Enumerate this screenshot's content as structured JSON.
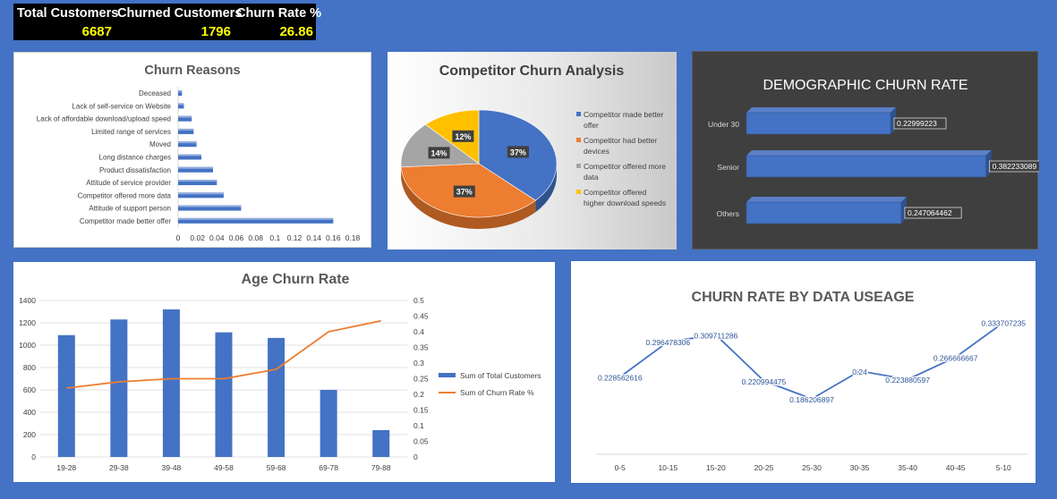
{
  "kpis": {
    "total_customers_label": "Total Customers",
    "total_customers_value": "6687",
    "churned_customers_label": "Churned Customers",
    "churned_customers_value": "1796",
    "churn_rate_label": "Churn Rate %",
    "churn_rate_value": "26.86"
  },
  "chart_data": [
    {
      "type": "bar",
      "orientation": "horizontal",
      "title": "Churn Reasons",
      "categories": [
        "Deceased",
        "Lack of self-service on Website",
        "Lack of affordable download/upload speed",
        "Limited range of services",
        "Moved",
        "Long distance charges",
        "Product dissatisfaction",
        "Attitude of service provider",
        "Competitor offered more data",
        "Attitude of support person",
        "Competitor made better offer"
      ],
      "values": [
        0.004,
        0.006,
        0.014,
        0.016,
        0.019,
        0.024,
        0.036,
        0.04,
        0.047,
        0.065,
        0.16
      ],
      "xlim": [
        0,
        0.18
      ],
      "xticks": [
        "0",
        "0.02",
        "0.04",
        "0.06",
        "0.08",
        "0.1",
        "0.12",
        "0.14",
        "0.16",
        "0.18"
      ],
      "color": "#4472c4"
    },
    {
      "type": "pie",
      "title": "Competitor Churn Analysis",
      "categories": [
        "Competitor made better offer",
        "Competitor had better devices",
        "Competitor offered more data",
        "Competitor offered higher download speeds"
      ],
      "values": [
        37,
        37,
        14,
        12
      ],
      "labels": [
        "37%",
        "37%",
        "14%",
        "12%"
      ],
      "colors": [
        "#4472c4",
        "#ed7d31",
        "#a5a5a5",
        "#ffc000"
      ],
      "legend_position": "right"
    },
    {
      "type": "bar",
      "orientation": "horizontal",
      "title": "DEMOGRAPHIC CHURN RATE",
      "categories": [
        "Under 30",
        "Senior",
        "Others"
      ],
      "values": [
        0.22999223,
        0.382233089,
        0.247064462
      ],
      "labels": [
        "0.22999223",
        "0.382233089",
        "0.247064462"
      ],
      "color": "#4472c4"
    },
    {
      "type": "bar",
      "title": "Age Churn Rate",
      "categories": [
        "19-28",
        "29-38",
        "39-48",
        "49-58",
        "59-68",
        "69-78",
        "79-88"
      ],
      "series": [
        {
          "name": "Sum of Total Customers",
          "type": "bar",
          "axis": "left",
          "color": "#4472c4",
          "values": [
            1090,
            1230,
            1320,
            1115,
            1065,
            600,
            240
          ]
        },
        {
          "name": "Sum of Churn Rate %",
          "type": "line",
          "axis": "right",
          "color": "#ed7d31",
          "values": [
            0.22,
            0.24,
            0.25,
            0.25,
            0.28,
            0.4,
            0.435
          ]
        }
      ],
      "ylim": [
        0,
        1400
      ],
      "yticks": [
        "0",
        "200",
        "400",
        "600",
        "800",
        "1000",
        "1200",
        "1400"
      ],
      "y2lim": [
        0,
        0.5
      ],
      "y2ticks": [
        "0",
        "0.05",
        "0.1",
        "0.15",
        "0.2",
        "0.25",
        "0.3",
        "0.35",
        "0.4",
        "0.45",
        "0.5"
      ],
      "legend_position": "right"
    },
    {
      "type": "line",
      "title": "CHURN RATE BY DATA USEAGE",
      "categories": [
        "0-5",
        "10-15",
        "15-20",
        "20-25",
        "25-30",
        "30-35",
        "35-40",
        "40-45",
        "5-10"
      ],
      "values": [
        0.228562616,
        0.296478306,
        0.309711286,
        0.220994475,
        0.186206897,
        0.24,
        0.223880597,
        0.266666667,
        0.333707235
      ],
      "labels": [
        "0.228562616",
        "0.296478306",
        "0.309711286",
        "0.220994475",
        "0.186206897",
        "0.24",
        "0.223880597",
        "0.266666667",
        "0.333707235"
      ],
      "color": "#4472c4"
    }
  ]
}
